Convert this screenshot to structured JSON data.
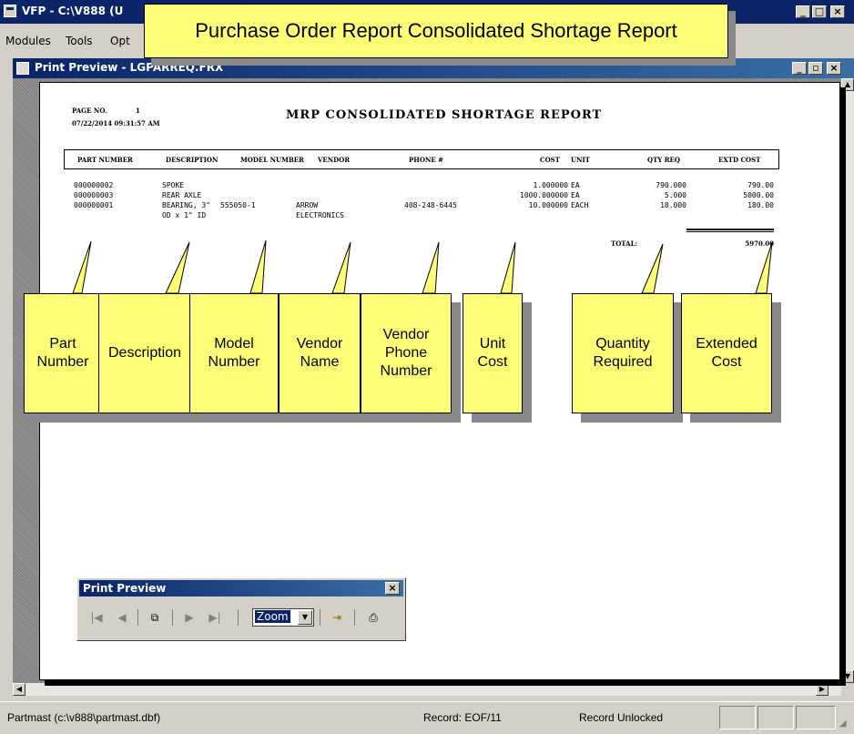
{
  "app": {
    "title": "VFP - C:\\V888 (U",
    "window_buttons": [
      "_",
      "□",
      "×"
    ]
  },
  "menu": {
    "items": [
      "Modules",
      "Tools",
      "Opt"
    ]
  },
  "callout_title": "Purchase Order Report Consolidated Shortage Report",
  "child_window": {
    "title": "Print Preview - LGPARREQ.FRX",
    "buttons": [
      "_",
      "▫",
      "×"
    ]
  },
  "report": {
    "page_label": "PAGE NO.",
    "page_number": "1",
    "datetime": "07/22/2014 09:31:57 AM",
    "title": "MRP CONSOLIDATED SHORTAGE REPORT",
    "columns": [
      "PART NUMBER",
      "DESCRIPTION",
      "MODEL NUMBER",
      "VENDOR",
      "PHONE #",
      "COST",
      "UNIT",
      "QTY REQ",
      "EXTD COST"
    ],
    "rows": [
      {
        "part": "000000002",
        "desc": "SPOKE",
        "desc2": "",
        "model": "",
        "vendor": "",
        "vendor2": "",
        "phone": "",
        "cost": "1.000000",
        "unit": "EA",
        "qty": "790.000",
        "ext": "790.00"
      },
      {
        "part": "000000003",
        "desc": "REAR AXLE",
        "desc2": "",
        "model": "",
        "vendor": "",
        "vendor2": "",
        "phone": "",
        "cost": "1000.000000",
        "unit": "EA",
        "qty": "5.000",
        "ext": "5000.00"
      },
      {
        "part": "000000001",
        "desc": "BEARING, 3\"",
        "desc2": "OD x 1\" ID",
        "model": "555050-1",
        "vendor": "ARROW",
        "vendor2": "ELECTRONICS",
        "phone": "408-248-6445",
        "cost": "10.000000",
        "unit": "EACH",
        "qty": "18.000",
        "ext": "180.00"
      }
    ],
    "total_label": "TOTAL:",
    "total_value": "5970.00"
  },
  "callouts": {
    "part_number": [
      "Part",
      "Number"
    ],
    "description": [
      "Description"
    ],
    "model_number": [
      "Model",
      "Number"
    ],
    "vendor_name": [
      "Vendor",
      "Name"
    ],
    "vendor_phone": [
      "Vendor",
      "Phone",
      "Number"
    ],
    "unit_cost": [
      "Unit",
      "Cost"
    ],
    "quantity_required": [
      "Quantity",
      "Required"
    ],
    "extended_cost": [
      "Extended",
      "Cost"
    ]
  },
  "preview_toolbar": {
    "title": "Print Preview",
    "close": "×",
    "zoom": "Zoom"
  },
  "status": {
    "file": "Partmast (c:\\v888\\partmast.dbf)",
    "record": "Record: EOF/11",
    "lock": "Record Unlocked"
  }
}
